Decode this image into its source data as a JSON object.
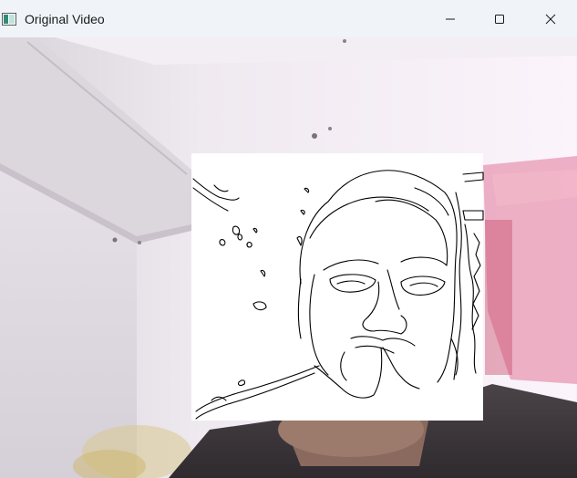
{
  "window": {
    "title": "Original Video",
    "app_icon": "opencv-window-icon",
    "controls": {
      "minimize_icon": "minimize-icon",
      "maximize_icon": "maximize-icon",
      "close_icon": "close-icon"
    }
  },
  "video": {
    "frame_description_icon": "webcam-frame",
    "overlay_icon": "edge-detection-overlay"
  },
  "colors": {
    "titlebar_bg": "#f0f4f9",
    "wall": "#f4eef3",
    "overlay_bg": "#ffffff",
    "edge_lines": "#000000",
    "accent_pink": "#e86a8e"
  }
}
